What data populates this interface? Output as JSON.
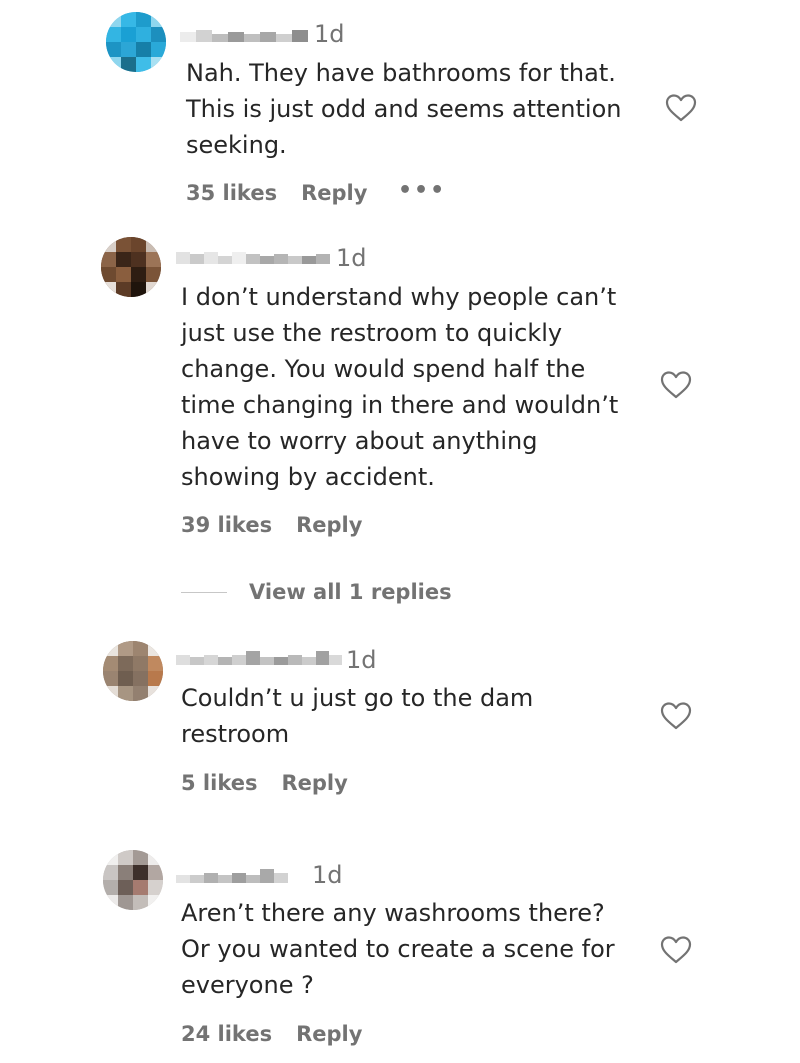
{
  "comments": [
    {
      "time": "1d",
      "text": "Nah. They have bathrooms for that.\nThis is just odd and seems attention\nseeking.",
      "likes": "35 likes",
      "reply": "Reply",
      "more": "•••"
    },
    {
      "time": "1d",
      "text": "I don’t understand why people can’t\njust use the restroom to quickly\nchange. You would spend half the\ntime changing in there and wouldn’t\nhave to worry about anything\nshowing by accident.",
      "likes": "39 likes",
      "reply": "Reply",
      "view_replies": "View all 1 replies"
    },
    {
      "time": "1d",
      "text": "Couldn’t u just go to the dam\nrestroom",
      "likes": "5 likes",
      "reply": "Reply"
    },
    {
      "time": "1d",
      "text": "Aren’t there any washrooms there?\nOr you wanted to create a scene for\neveryone ?",
      "likes": "24 likes",
      "reply": "Reply"
    }
  ],
  "colors": {
    "text": "#262626",
    "secondary": "#737373",
    "background": "#ffffff"
  }
}
